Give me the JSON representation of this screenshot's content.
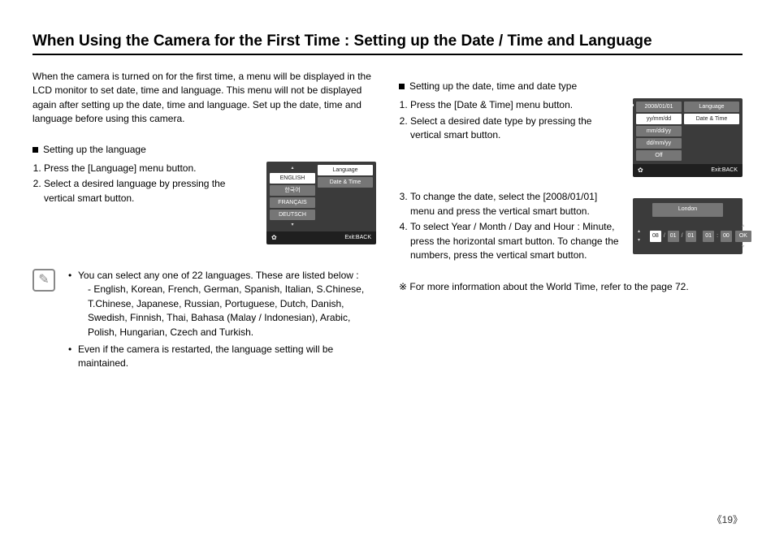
{
  "title": "When Using the Camera for the First Time : Setting up the Date / Time and Language",
  "intro": "When the camera is turned on for the first time, a menu will be displayed in the LCD monitor to set date, time and language. This menu will not be displayed again after setting up the date, time and language. Set up the date, time and language before using this camera.",
  "left": {
    "heading": "Setting up the language",
    "steps": [
      "Press the [Language] menu button.",
      "Select a desired language by pressing the vertical smart button."
    ]
  },
  "note": {
    "bullets": [
      "You can select any one of 22 languages. These are listed below :",
      "Even if the camera is restarted, the language setting will be maintained."
    ],
    "lang_list": "- English, Korean, French, German, Spanish, Italian, S.Chinese, T.Chinese, Japanese, Russian, Portuguese, Dutch, Danish, Swedish, Finnish, Thai, Bahasa (Malay / Indonesian), Arabic, Polish, Hungarian, Czech and Turkish."
  },
  "right": {
    "heading": "Setting up the date, time and date type",
    "steps_a": [
      "Press the [Date & Time] menu button.",
      "Select a desired date type by pressing the vertical smart button."
    ],
    "steps_b": [
      "To change the date, select the [2008/01/01] menu and press the vertical smart button.",
      "To select Year / Month / Day and Hour : Minute, press the horizontal smart button. To change the numbers, press the vertical smart button."
    ],
    "more": "※ For more information about the World Time, refer to the page 72."
  },
  "lcd_lang": {
    "options": [
      "ENGLISH",
      "한국어",
      "FRANÇAIS",
      "DEUTSCH"
    ],
    "tabs": [
      "Language",
      "Date & Time"
    ],
    "exit": "Exit:BACK"
  },
  "lcd_date": {
    "date_top": "2008/01/01",
    "options": [
      "yy/mm/dd",
      "mm/dd/yy",
      "dd/mm/yy",
      "Off"
    ],
    "tabs": [
      "Language",
      "Date & Time"
    ],
    "exit": "Exit:BACK"
  },
  "lcd_city": {
    "city": "London",
    "vals": [
      "08",
      "01",
      "01",
      "01",
      "00"
    ],
    "ok": "OK"
  },
  "page_number": "《19》"
}
